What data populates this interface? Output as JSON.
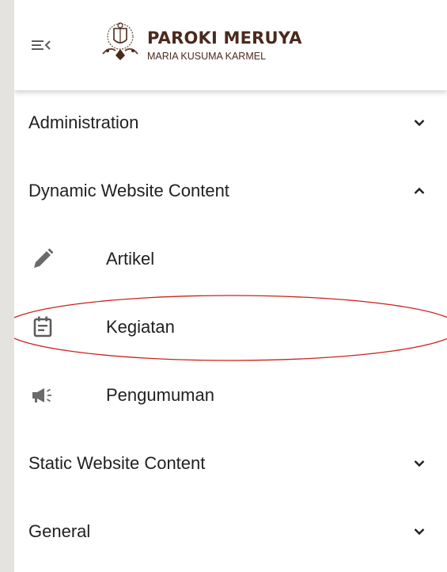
{
  "header": {
    "menu_icon": "menu-collapse-icon",
    "logo_icon": "parish-crest-logo",
    "title": "PAROKI MERUYA",
    "subtitle": "MARIA KUSUMA KARMEL"
  },
  "nav": {
    "sections": [
      {
        "label": "Administration",
        "expanded": false,
        "chevron": "chevron-down-icon"
      },
      {
        "label": "Dynamic Website Content",
        "expanded": true,
        "chevron": "chevron-up-icon",
        "items": [
          {
            "label": "Artikel",
            "icon": "pencil-icon"
          },
          {
            "label": "Kegiatan",
            "icon": "calendar-icon",
            "highlighted": true
          },
          {
            "label": "Pengumuman",
            "icon": "megaphone-icon"
          }
        ]
      },
      {
        "label": "Static Website Content",
        "expanded": false,
        "chevron": "chevron-down-icon"
      },
      {
        "label": "General",
        "expanded": false,
        "chevron": "chevron-down-icon"
      }
    ]
  },
  "colors": {
    "brand": "#4a2a1c",
    "text": "#212121",
    "icon": "#6b6b6b",
    "highlight_annotation": "#cc2222",
    "background": "#e5e3e0"
  }
}
